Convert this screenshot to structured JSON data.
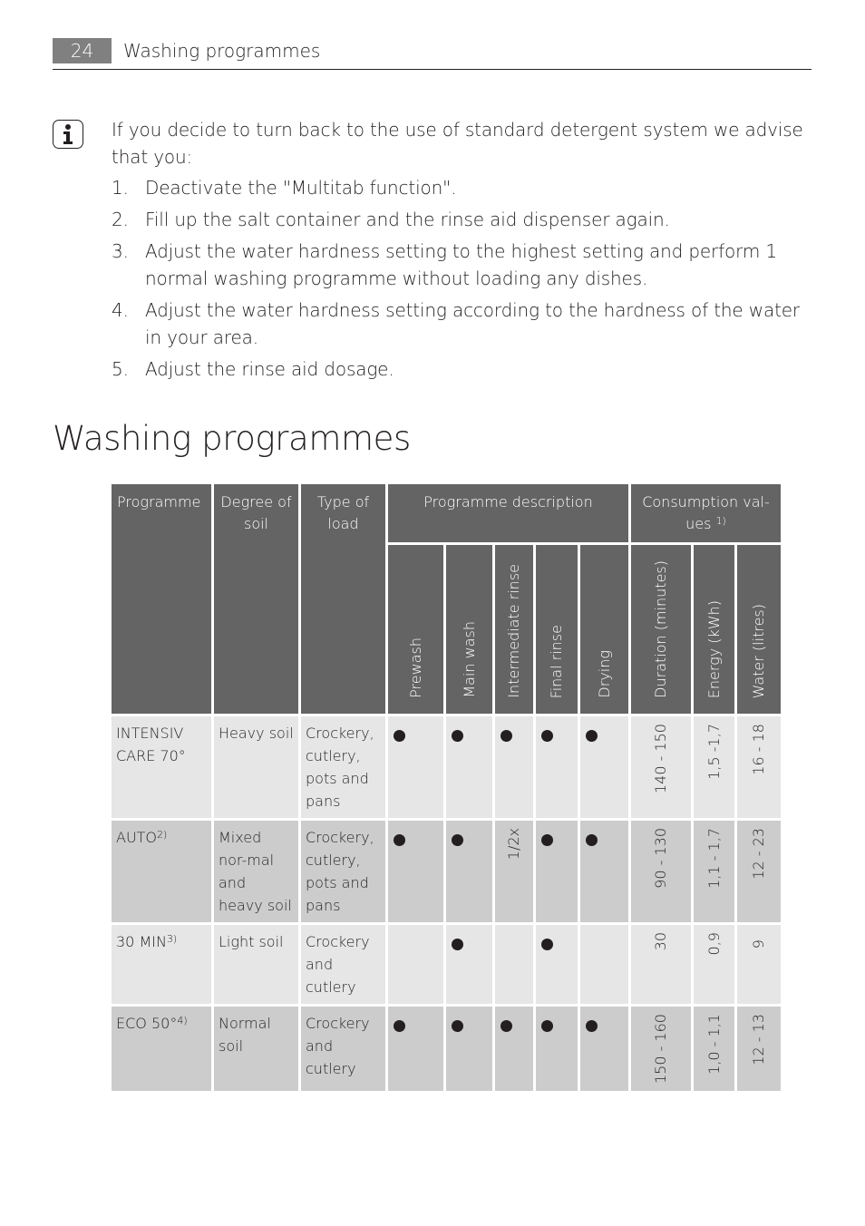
{
  "header": {
    "page_number": "24",
    "section_title": "Washing programmes"
  },
  "note": {
    "icon": "info-icon",
    "intro": "If you decide to turn back to the use of standard detergent system we advise that you:",
    "steps": [
      {
        "num": "1.",
        "text": "Deactivate the \"Multitab function\"."
      },
      {
        "num": "2.",
        "text": "Fill up the salt container and the rinse aid dispenser again."
      },
      {
        "num": "3.",
        "text": "Adjust the water hardness setting to the highest setting and perform 1 normal washing programme without loading any dishes."
      },
      {
        "num": "4.",
        "text": "Adjust the water hardness setting according to the hardness of the water in your area."
      },
      {
        "num": "5.",
        "text": "Adjust the rinse aid dosage."
      }
    ]
  },
  "heading": "Washing programmes",
  "table": {
    "headers": {
      "programme": "Programme",
      "degree_of_soil": "Degree of soil",
      "type_of_load": "Type of load",
      "programme_description": "Programme description",
      "consumption_values": "Consumption val-ues",
      "consumption_footnote": "1)",
      "prewash": "Prewash",
      "main_wash": "Main wash",
      "intermediate_rinse": "Intermediate rinse",
      "final_rinse": "Final rinse",
      "drying": "Drying",
      "duration": "Duration (minutes)",
      "energy": "Energy (kWh)",
      "water": "Water (litres)"
    },
    "rows": [
      {
        "programme": "INTENSIV CARE 70°",
        "footnote": "",
        "soil": "Heavy soil",
        "load": "Crockery, cutlery, pots and pans",
        "prewash": true,
        "main_wash": true,
        "intermediate_rinse": "dot",
        "final_rinse": true,
        "drying": true,
        "duration": "140 - 150",
        "energy": "1,5 -1,7",
        "water": "16 - 18"
      },
      {
        "programme": "AUTO",
        "footnote": "2)",
        "soil": "Mixed nor-mal and heavy soil",
        "load": "Crockery, cutlery, pots and pans",
        "prewash": true,
        "main_wash": true,
        "intermediate_rinse": "1/2x",
        "final_rinse": true,
        "drying": true,
        "duration": "90 - 130",
        "energy": "1,1 - 1,7",
        "water": "12 - 23"
      },
      {
        "programme": "30 MIN",
        "footnote": "3)",
        "soil": "Light soil",
        "load": "Crockery and cutlery",
        "prewash": false,
        "main_wash": true,
        "intermediate_rinse": "",
        "final_rinse": true,
        "drying": false,
        "duration": "30",
        "energy": "0,9",
        "water": "9"
      },
      {
        "programme": "ECO 50°",
        "footnote": "4)",
        "soil": "Normal soil",
        "load": "Crockery and cutlery",
        "prewash": true,
        "main_wash": true,
        "intermediate_rinse": "dot",
        "final_rinse": true,
        "drying": true,
        "duration": "150 - 160",
        "energy": "1,0 - 1,1",
        "water": "12 - 13"
      }
    ]
  }
}
